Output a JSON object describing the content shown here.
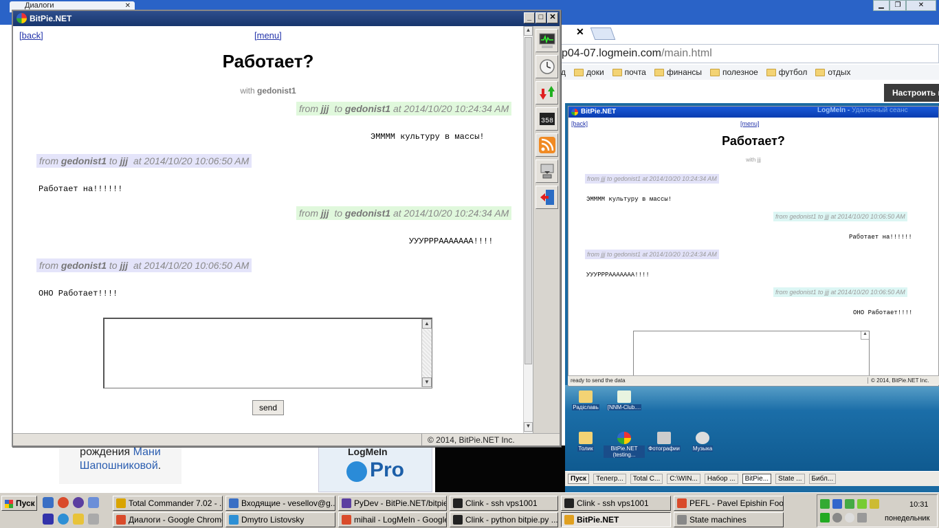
{
  "chrome": {
    "tab_label": "Диалоги",
    "url_partial": "p04-07.logmein.com",
    "url_path": "/main.html",
    "bookmarks": [
      "доки",
      "почта",
      "финансы",
      "полезное",
      "футбол",
      "отдых"
    ],
    "bookmark_partial": "д",
    "nastroit": "Настроить па",
    "birth_line1": "рождения",
    "birth_link1": "Мани",
    "birth_link2": "Шапошниковой",
    "birth_dot": ".",
    "logmein_title": "LogMeIn",
    "logmein_pro": "Pro"
  },
  "window": {
    "title": "BitPie.NET",
    "nav_back": "[back]",
    "nav_menu": "[menu]",
    "heading": "Работает?",
    "with_label": "with",
    "with_user": "gedonist1",
    "messages": [
      {
        "from_word": "from",
        "from": "jjj",
        "to_word": "to",
        "to": "gedonist1",
        "at": "at 2014/10/20 10:24:34 AM",
        "text": "ЭММММ культуру в массы!"
      },
      {
        "from_word": "from",
        "from": "gedonist1",
        "to_word": "to",
        "to": "jjj",
        "at": "at 2014/10/20 10:06:50 AM",
        "text": "Работает на!!!!!!"
      },
      {
        "from_word": "from",
        "from": "jjj",
        "to_word": "to",
        "to": "gedonist1",
        "at": "at 2014/10/20 10:24:34 AM",
        "text": "УУУРРРААААААА!!!!"
      },
      {
        "from_word": "from",
        "from": "gedonist1",
        "to_word": "to",
        "to": "jjj",
        "at": "at 2014/10/20 10:06:50 AM",
        "text": "ОНО Работает!!!!"
      }
    ],
    "message_input_value": "",
    "send_label": "send",
    "status_copyright": "© 2014, BitPie.NET Inc.",
    "toolbar_icons": [
      "monitor-icon",
      "clock-icon",
      "transfer-icon",
      "counter-icon",
      "rss-icon",
      "download-icon",
      "exit-icon"
    ],
    "counter_text": "358"
  },
  "remote": {
    "title": "BitPie.NET",
    "logmein_label": "LogMeIn -",
    "logmein_sub": "Удаленный сеанс",
    "nav_back": "[back]",
    "nav_menu": "[menu]",
    "heading": "Работает?",
    "with_line": "with jjj",
    "metas": [
      "from jjj to gedonist1 at 2014/10/20 10:24:34 AM",
      "from gedonist1 to jjj at 2014/10/20 10:06:50 AM",
      "from jjj to gedonist1 at 2014/10/20 10:24:34 AM",
      "from gedonist1 to jjj at 2014/10/20 10:06:50 AM"
    ],
    "texts": [
      "ЭММММ культуру в массы!",
      "Работает на!!!!!!",
      "УУУРРРААААААА!!!!",
      "ОНО Работает!!!!"
    ],
    "status_left": "ready to send the data",
    "status_right": "© 2014, BitPie.NET Inc.",
    "desktop_icons": [
      "Радіславь",
      "[NNM-Club....",
      "Толик",
      "BitPie.NET (testing...",
      "Фотографии",
      "Музыка"
    ],
    "taskbar_start": "Пуск",
    "taskbar_items": [
      "Телегр...",
      "Total C...",
      "C:\\WIN...",
      "Набор ...",
      "BitPie...",
      "State ...",
      "Библ..."
    ]
  },
  "taskbar": {
    "start": "Пуск",
    "row1": [
      {
        "label": "Total Commander 7.02 - ...",
        "icon_color": "#d9a400"
      },
      {
        "label": "Входящие - vesellov@g...",
        "icon_color": "#3a6fc4"
      },
      {
        "label": "PyDev - BitPie.NET/bitpie...",
        "icon_color": "#5b3fa0"
      },
      {
        "label": "Clink  - ssh vps1001",
        "icon_color": "#222222"
      },
      {
        "label": "Clink  - ssh vps1001",
        "icon_color": "#222222"
      },
      {
        "label": "PEFL - Pavel Epishin Foot...",
        "icon_color": "#d94b2b"
      }
    ],
    "row2": [
      {
        "label": "Диалоги - Google Chrome",
        "icon_color": "#d94b2b"
      },
      {
        "label": "Dmytro Listovsky",
        "icon_color": "#2d8fd5"
      },
      {
        "label": "mihail - LogMeIn - Google...",
        "icon_color": "#d94b2b"
      },
      {
        "label": "Clink  - python bitpie.py ...",
        "icon_color": "#222222"
      },
      {
        "label": "BitPie.NET",
        "icon_color": "#e0a020"
      },
      {
        "label": "State machines",
        "icon_color": "#888888"
      }
    ],
    "clock": "10:31",
    "day": "понедельник"
  }
}
